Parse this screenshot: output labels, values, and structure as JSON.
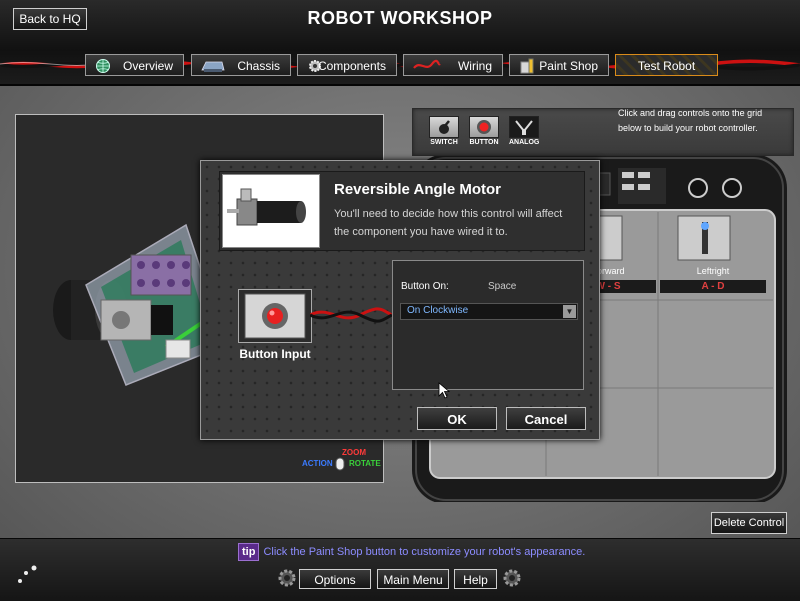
{
  "header": {
    "title": "ROBOT WORKSHOP",
    "back_label": "Back to HQ",
    "tabs": [
      {
        "label": "Overview",
        "icon": "globe-icon"
      },
      {
        "label": "Chassis",
        "icon": "chassis-icon"
      },
      {
        "label": "Components",
        "icon": "gear-icon"
      },
      {
        "label": "Wiring",
        "icon": "wire-icon"
      },
      {
        "label": "Paint Shop",
        "icon": "paint-can-icon"
      },
      {
        "label": "Test Robot",
        "icon": "",
        "active": true
      }
    ]
  },
  "viewport": {
    "zoom_label": "ZOOM",
    "action_label": "ACTION",
    "rotate_label": "ROTATE",
    "colors": {
      "action": "#3b7bff",
      "zoom": "#ff3a3a",
      "rotate": "#3ad03a"
    }
  },
  "palette": {
    "items": [
      {
        "label": "SWITCH",
        "icon": "switch-icon"
      },
      {
        "label": "BUTTON",
        "icon": "button-icon"
      },
      {
        "label": "ANALOG",
        "icon": "analog-stick-icon"
      }
    ],
    "help_text": "Click and drag controls onto the grid below to build your robot controller."
  },
  "controller": {
    "slots": [
      {
        "label": "Forward",
        "keys": "W - S"
      },
      {
        "label": "Leftright",
        "keys": "A - D"
      }
    ],
    "delete_label": "Delete Control"
  },
  "dialog": {
    "title": "Reversible Angle Motor",
    "description": "You'll need to decide how this control will affect the component you have wired it to.",
    "input_label": "Button Input",
    "config_label": "Button On:",
    "config_value": "Space",
    "select_value": "On Clockwise",
    "ok_label": "OK",
    "cancel_label": "Cancel"
  },
  "footer": {
    "tip_badge": "tip",
    "tip_text": "Click the Paint Shop button to customize your robot's appearance.",
    "options_label": "Options",
    "main_menu_label": "Main Menu",
    "help_label": "Help"
  }
}
